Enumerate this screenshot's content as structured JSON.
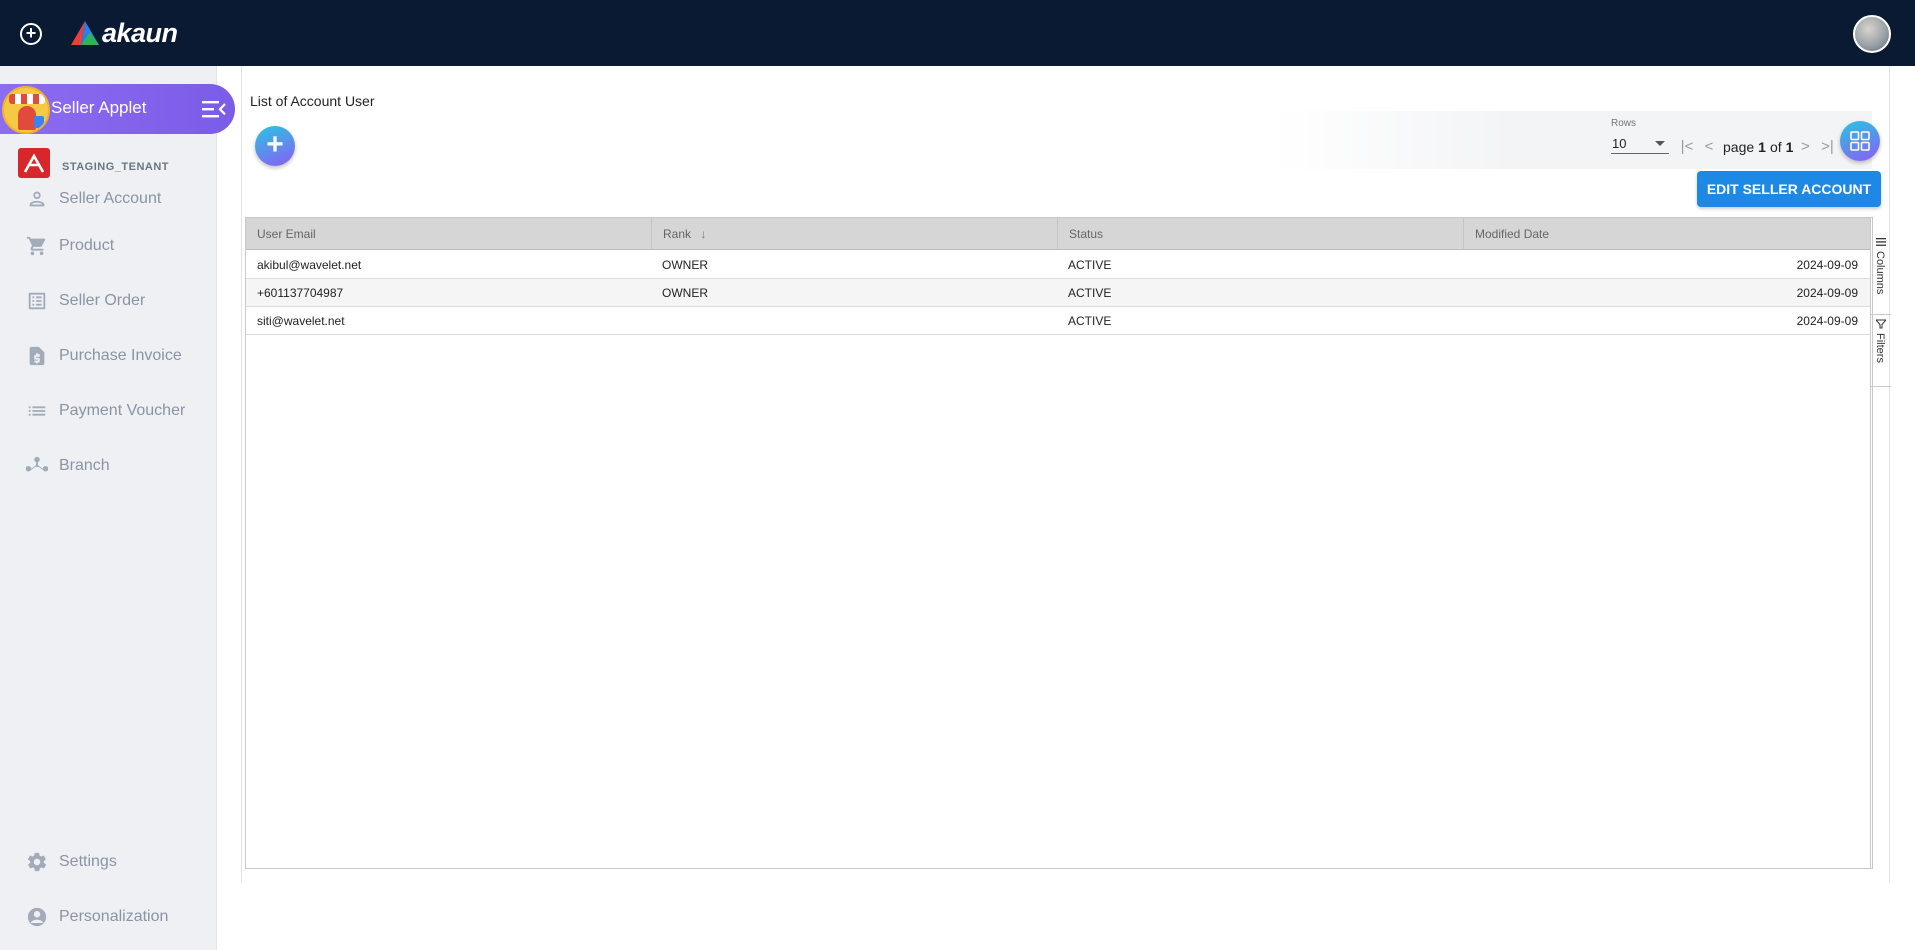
{
  "app": {
    "brand": "akaun"
  },
  "sidebar": {
    "applet_label": "Seller Applet",
    "tenant_name": "STAGING_TENANT",
    "items": [
      {
        "label": "Seller Account",
        "icon": "person-icon"
      },
      {
        "label": "Product",
        "icon": "cart-icon"
      },
      {
        "label": "Seller Order",
        "icon": "list-alt-icon"
      },
      {
        "label": "Purchase Invoice",
        "icon": "invoice-icon"
      },
      {
        "label": "Payment Voucher",
        "icon": "list-icon"
      },
      {
        "label": "Branch",
        "icon": "branch-icon"
      }
    ],
    "bottom_items": [
      {
        "label": "Settings",
        "icon": "gear-icon"
      },
      {
        "label": "Personalization",
        "icon": "user-circle-icon"
      }
    ]
  },
  "main": {
    "title": "List of Account User",
    "rows_label": "Rows",
    "rows_value": "10",
    "pager": {
      "prefix": "page",
      "current": "1",
      "of": "of",
      "total": "1"
    },
    "edit_button": "EDIT SELLER ACCOUNT"
  },
  "grid": {
    "columns": [
      "User Email",
      "Rank",
      "Status",
      "Modified Date"
    ],
    "rows": [
      {
        "email": "akibul@wavelet.net",
        "rank": "OWNER",
        "status": "ACTIVE",
        "modified": "2024-09-09"
      },
      {
        "email": "+601137704987",
        "rank": "OWNER",
        "status": "ACTIVE",
        "modified": "2024-09-09"
      },
      {
        "email": "siti@wavelet.net",
        "rank": "",
        "status": "ACTIVE",
        "modified": "2024-09-09"
      }
    ],
    "side_tabs": [
      "Columns",
      "Filters"
    ]
  },
  "colors": {
    "topbar": "#0b1a33",
    "applet_pill": "#8c6cf0",
    "primary_button": "#1e88e5",
    "tenant_logo": "#d8272b"
  }
}
